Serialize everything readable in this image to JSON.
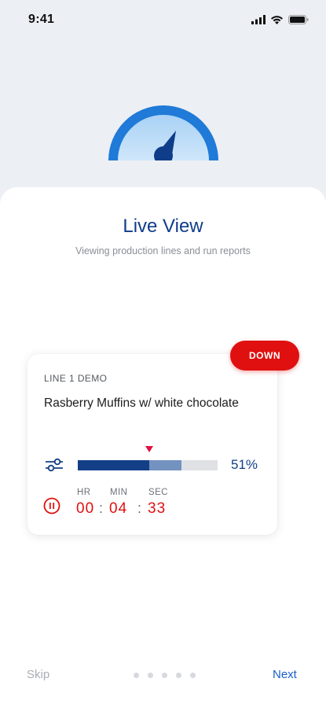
{
  "status_bar": {
    "time": "9:41",
    "icons": [
      "signal-icon",
      "wifi-icon",
      "battery-icon"
    ]
  },
  "hero": {
    "icon": "speedometer-icon"
  },
  "onboarding": {
    "title": "Live View",
    "subtitle": "Viewing production lines and run reports"
  },
  "card": {
    "status_badge": "DOWN",
    "line_name": "LINE 1 DEMO",
    "product_name": "Rasberry Muffins w/ white chocolate",
    "progress": {
      "percent_label": "51%",
      "fill_fraction": 0.51,
      "secondary_fraction": 0.74,
      "marker_fraction": 0.51
    },
    "timer": {
      "hr_label": "HR",
      "min_label": "MIN",
      "sec_label": "SEC",
      "hr": "00",
      "min": "04",
      "sec": "33",
      "separator": ":"
    }
  },
  "footer": {
    "skip_label": "Skip",
    "next_label": "Next",
    "page_count": 5
  },
  "colors": {
    "brand_blue": "#123f86",
    "accent_red": "#e01010",
    "link_blue": "#1a5fc7"
  }
}
